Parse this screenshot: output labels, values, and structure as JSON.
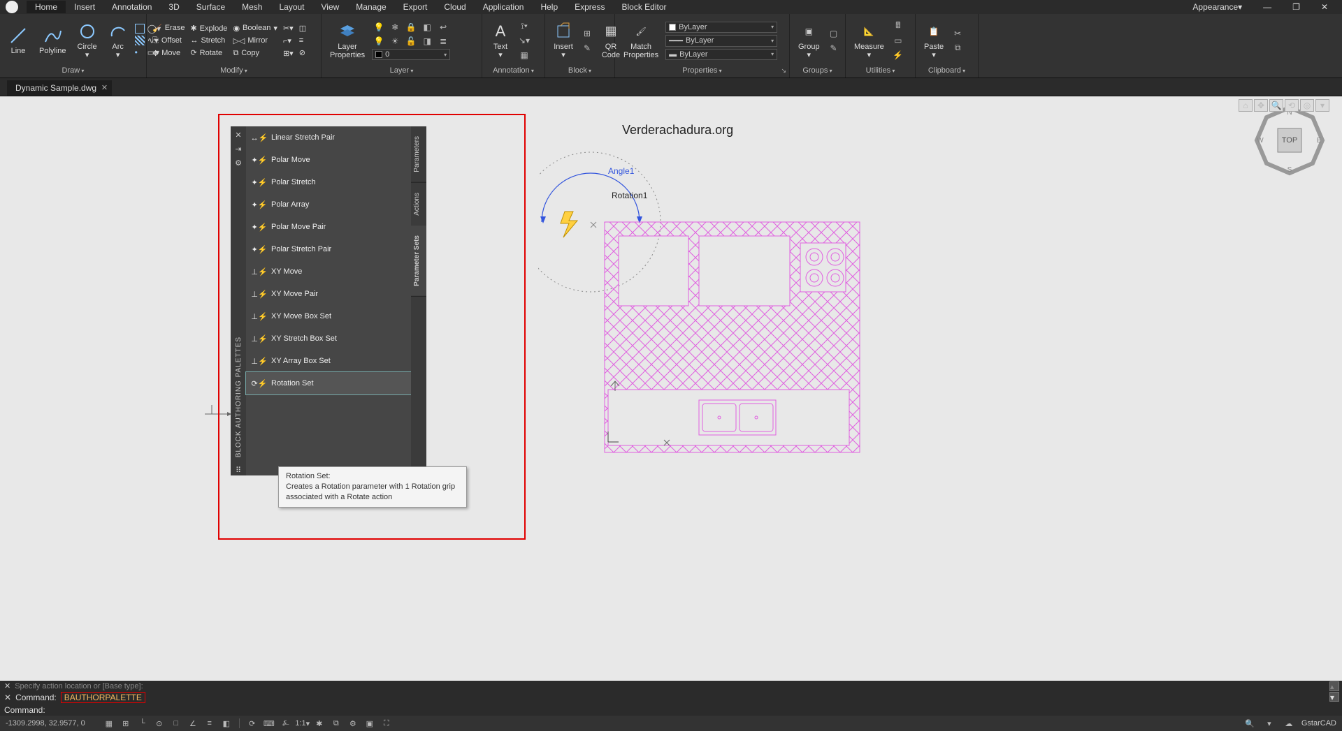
{
  "menu": {
    "items": [
      "Home",
      "Insert",
      "Annotation",
      "3D",
      "Surface",
      "Mesh",
      "Layout",
      "View",
      "Manage",
      "Export",
      "Cloud",
      "Application",
      "Help",
      "Express",
      "Block Editor"
    ],
    "active": "Home",
    "appearance": "Appearance"
  },
  "ribbon": {
    "draw": {
      "title": "Draw",
      "line": "Line",
      "polyline": "Polyline",
      "circle": "Circle",
      "arc": "Arc"
    },
    "modify": {
      "title": "Modify",
      "erase": "Erase",
      "explode": "Explode",
      "boolean": "Boolean",
      "offset": "Offset",
      "stretch": "Stretch",
      "mirror": "Mirror",
      "move": "Move",
      "rotate": "Rotate",
      "copy": "Copy"
    },
    "layer": {
      "title": "Layer",
      "props": "Layer\nProperties",
      "current": "0"
    },
    "annotation": {
      "title": "Annotation",
      "text": "Text"
    },
    "block": {
      "title": "Block",
      "insert": "Insert",
      "qr": "QR\nCode"
    },
    "properties": {
      "title": "Properties",
      "match": "Match\nProperties",
      "bylayer": "ByLayer"
    },
    "groups": {
      "title": "Groups",
      "group": "Group"
    },
    "utilities": {
      "title": "Utilities",
      "measure": "Measure"
    },
    "clipboard": {
      "title": "Clipboard",
      "paste": "Paste"
    }
  },
  "file_tab": "Dynamic Sample.dwg",
  "canvas": {
    "watermark": "Verderachadura.org",
    "angle_label": "Angle1",
    "rotation_label": "Rotation1",
    "viewcube_face": "TOP"
  },
  "palette": {
    "title": "BLOCK AUTHORING PALETTES",
    "tabs": [
      "Parameters",
      "Actions",
      "Parameter Sets"
    ],
    "active_tab": "Parameter Sets",
    "items": [
      "Linear Stretch Pair",
      "Polar Move",
      "Polar Stretch",
      "Polar Array",
      "Polar Move Pair",
      "Polar Stretch Pair",
      "XY Move",
      "XY Move Pair",
      "XY Move Box Set",
      "XY Stretch Box Set",
      "XY Array Box Set",
      "Rotation Set"
    ],
    "selected": "Rotation Set"
  },
  "tooltip": {
    "title": "Rotation Set:",
    "body": "Creates a Rotation parameter with 1 Rotation grip associated with a Rotate action"
  },
  "command": {
    "prev_line": "Specify action location or [Base type]:",
    "label": "Command:",
    "entered": "BAUTHORPALETTE",
    "prompt": "Command:"
  },
  "status": {
    "coords": "-1309.2998, 32.9577, 0",
    "scale": "1:1",
    "brand": "GstarCAD"
  }
}
